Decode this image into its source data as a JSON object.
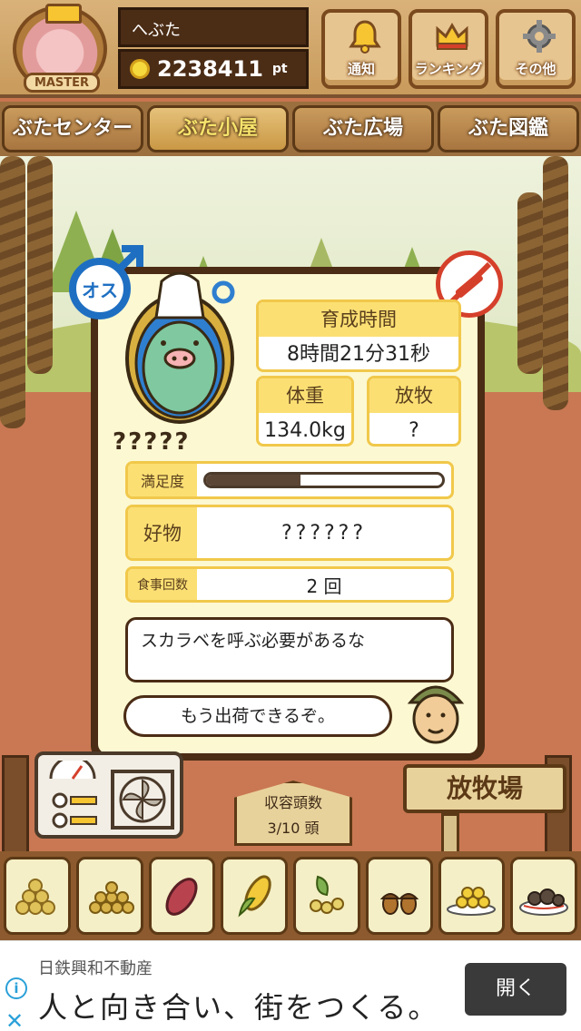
{
  "user": {
    "name": "へぶた",
    "points": "2238411",
    "points_unit": "pt",
    "badge": "MASTER"
  },
  "header_buttons": [
    {
      "label": "通知",
      "icon": "bell-icon"
    },
    {
      "label": "ランキング",
      "icon": "crown-icon"
    },
    {
      "label": "その他",
      "icon": "gear-icon"
    }
  ],
  "tabs": [
    {
      "label": "ぶたセンター",
      "active": false
    },
    {
      "label": "ぶた小屋",
      "active": true
    },
    {
      "label": "ぶた広場",
      "active": false
    },
    {
      "label": "ぶた図鑑",
      "active": false
    }
  ],
  "pig": {
    "gender_label": "オス",
    "name": "?????",
    "raising_time_label": "育成時間",
    "raising_time": "8時間21分31秒",
    "weight_label": "体重",
    "weight": "134.0kg",
    "grazing_label": "放牧",
    "grazing": "?",
    "satisfaction_label": "満足度",
    "satisfaction_level": 0.4,
    "favorite_label": "好物",
    "favorite": "??????",
    "meals_label": "食事回数",
    "meals": "2 回"
  },
  "messages": {
    "hint": "スカラベを呼ぶ必要があるな",
    "farmer": "もう出荷できるぞ。"
  },
  "capacity": {
    "label": "収容頭数",
    "value": "3/10 頭"
  },
  "pasture_sign": "放牧場",
  "feeds": [
    {
      "icon": "soybeans-icon"
    },
    {
      "icon": "grain-pile-icon"
    },
    {
      "icon": "sweet-potato-icon"
    },
    {
      "icon": "corn-icon"
    },
    {
      "icon": "herb-berries-icon"
    },
    {
      "icon": "acorn-icon"
    },
    {
      "icon": "grain-plate-icon"
    },
    {
      "icon": "truffle-plate-icon"
    }
  ],
  "ad": {
    "advertiser": "日鉄興和不動産",
    "headline": "人と向き合い、街をつくる。",
    "cta": "開く"
  },
  "colors": {
    "wood_dark": "#4b2c15",
    "tab_active_text": "#f6e36c",
    "card_bg": "#fcf8d2",
    "label_bg": "#fbdf73",
    "male_blue": "#1e6fc2",
    "no_red": "#d5402b"
  }
}
